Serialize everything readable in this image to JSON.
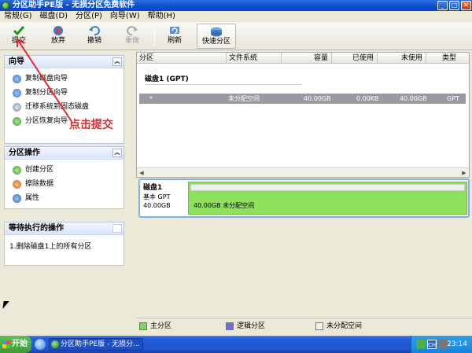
{
  "window": {
    "title": "分区助手PE版 - 无损分区免费软件"
  },
  "menu": [
    "常规(G)",
    "磁盘(D)",
    "分区(P)",
    "向导(W)",
    "帮助(H)"
  ],
  "toolbar": {
    "commit": "提交",
    "discard": "放弃",
    "undo": "撤销",
    "redo": "重做",
    "refresh": "刷新",
    "quick_partition": "快速分区"
  },
  "wizard_panel": {
    "title": "向导",
    "items": [
      "复制磁盘向导",
      "复制分区向导",
      "迁移系统到固态磁盘",
      "分区恢复向导"
    ]
  },
  "partition_ops_panel": {
    "title": "分区操作",
    "items": [
      "创建分区",
      "擦除数据",
      "属性"
    ]
  },
  "pending_panel": {
    "title": "等待执行的操作",
    "items": [
      "1.删除磁盘1上的所有分区"
    ]
  },
  "grid": {
    "columns": [
      "分区",
      "文件系统",
      "容量",
      "已使用",
      "未使用",
      "类型"
    ],
    "disk_title": "磁盘1 (GPT)",
    "rows": [
      {
        "partition": "*",
        "filesystem": "未分配空间",
        "capacity": "40.00GB",
        "used": "0.00KB",
        "unused": "40.00GB",
        "type": "GPT"
      }
    ]
  },
  "disk_map": {
    "name": "磁盘1",
    "kind": "基本 GPT",
    "size": "40.00GB",
    "bar_label": "40.00GB 未分配空间"
  },
  "legend": [
    {
      "label": "主分区",
      "color": "#7fd45a"
    },
    {
      "label": "逻辑分区",
      "color": "#6f6fd8"
    },
    {
      "label": "未分配空间",
      "color": "#f4f4ee"
    }
  ],
  "annotation": "点击提交",
  "taskbar": {
    "start": "开始",
    "task": "分区助手PE版 - 无损分...",
    "tray_input": "CH",
    "clock": "23:14"
  }
}
